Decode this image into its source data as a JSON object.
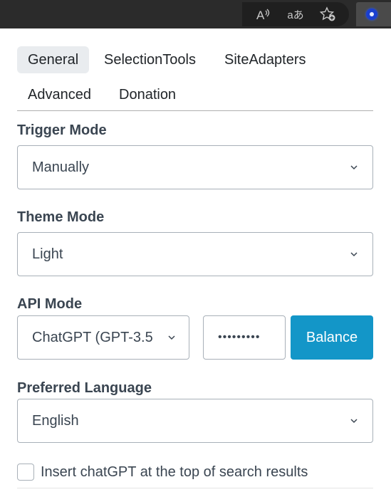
{
  "browser_toolbar": {
    "icons": [
      "read-aloud-icon",
      "translate-icon",
      "add-favorite-icon",
      "extension-icon"
    ],
    "read_aloud_glyph": "A",
    "translate_glyph": "aあ",
    "favorite_glyph": "☆"
  },
  "tabs": [
    {
      "label": "General",
      "active": true
    },
    {
      "label": "SelectionTools",
      "active": false
    },
    {
      "label": "SiteAdapters",
      "active": false
    },
    {
      "label": "Advanced",
      "active": false
    },
    {
      "label": "Donation",
      "active": false
    }
  ],
  "trigger_mode": {
    "label": "Trigger Mode",
    "value": "Manually"
  },
  "theme_mode": {
    "label": "Theme Mode",
    "value": "Light"
  },
  "api_mode": {
    "label": "API Mode",
    "value": "ChatGPT (GPT-3.5",
    "api_key_masked": "•••••••••",
    "balance_label": "Balance"
  },
  "preferred_language": {
    "label": "Preferred Language",
    "value": "English"
  },
  "insert_option": {
    "label": "Insert chatGPT at the top of search results",
    "checked": false
  },
  "colors": {
    "accent": "#1396c8",
    "active_tab_bg": "#e9ecef",
    "toolbar_bg": "#2b2b2b"
  }
}
